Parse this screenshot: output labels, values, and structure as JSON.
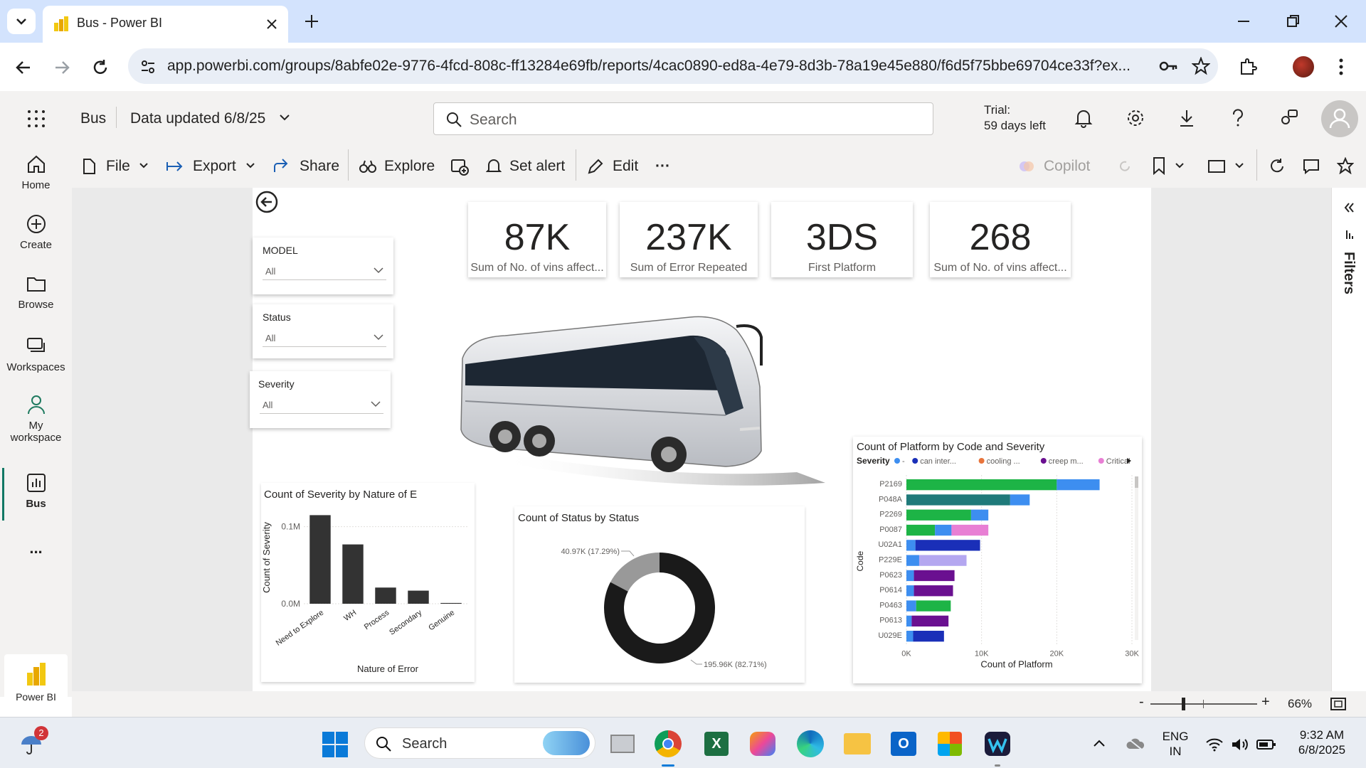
{
  "browser": {
    "tab_title": "Bus - Power BI",
    "url": "app.powerbi.com/groups/8abfe02e-9776-4fcd-808c-ff13284e69fb/reports/4cac0890-ed8a-4e79-8d3b-78a19e45e880/f6d5f75bbe69704ce33f?ex..."
  },
  "header": {
    "app_name": "Bus",
    "data_updated": "Data updated 6/8/25",
    "search_placeholder": "Search",
    "trial_line1": "Trial:",
    "trial_line2": "59 days left"
  },
  "nav": {
    "home": "Home",
    "create": "Create",
    "browse": "Browse",
    "workspaces": "Workspaces",
    "my_workspace_1": "My",
    "my_workspace_2": "workspace",
    "bus": "Bus",
    "more": "...",
    "powerbi": "Power BI"
  },
  "toolbar": {
    "file": "File",
    "export": "Export",
    "share": "Share",
    "explore": "Explore",
    "set_alert": "Set alert",
    "edit": "Edit",
    "more": "···",
    "copilot": "Copilot"
  },
  "kpis": [
    {
      "value": "87K",
      "label": "Sum of No. of vins affect..."
    },
    {
      "value": "237K",
      "label": "Sum of Error Repeated"
    },
    {
      "value": "3DS",
      "label": "First Platform"
    },
    {
      "value": "268",
      "label": "Sum of No. of vins affect..."
    }
  ],
  "slicers": [
    {
      "label": "MODEL",
      "value": "All"
    },
    {
      "label": "Status",
      "value": "All"
    },
    {
      "label": "Severity",
      "value": "All"
    }
  ],
  "filters_label": "Filters",
  "zoom": "66%",
  "colors": {
    "bar_dark": "#333333",
    "donut_dark": "#1a1a1a",
    "donut_light": "#999999",
    "green": "#1db446",
    "blue": "#3d8ef0",
    "teal": "#1f7a7a",
    "navy": "#1a2fb8",
    "purple": "#6a1090",
    "pink": "#e87fd4",
    "lavender": "#b4a7f0"
  },
  "chart_data": [
    {
      "type": "bar",
      "title": "Count of Severity by Nature of E",
      "xlabel": "Nature of Error",
      "ylabel": "Count of Severity",
      "categories": [
        "Need to Explore",
        "WH",
        "Process",
        "Secondary",
        "Genuine"
      ],
      "values": [
        0.115,
        0.077,
        0.021,
        0.017,
        0.001
      ],
      "yticks": [
        "0.1M",
        "0.0M"
      ],
      "ylim": [
        0,
        0.12
      ]
    },
    {
      "type": "pie",
      "title": "Count of Status by Status",
      "labels": [
        "40.97K (17.29%)",
        "195.96K (82.71%)"
      ],
      "values": [
        40.97,
        195.96
      ],
      "percents": [
        17.29,
        82.71
      ]
    },
    {
      "type": "bar",
      "orientation": "horizontal",
      "stacked": true,
      "title": "Count of Platform by Code and Severity",
      "xlabel": "Count of Platform",
      "ylabel": "Code",
      "legend_title": "Severity",
      "legend": [
        {
          "name": "-",
          "color": "#3d8ef0"
        },
        {
          "name": "can inter...",
          "color": "#1a2fb8"
        },
        {
          "name": "cooling ...",
          "color": "#e8743b"
        },
        {
          "name": "creep m...",
          "color": "#6a1090"
        },
        {
          "name": "Critical",
          "color": "#e87fd4"
        }
      ],
      "xticks": [
        "0K",
        "10K",
        "20K",
        "30K"
      ],
      "xlim": [
        0,
        30000
      ],
      "rows": [
        {
          "code": "P2169",
          "segments": [
            {
              "v": 20000,
              "c": "#1db446"
            },
            {
              "v": 5700,
              "c": "#3d8ef0"
            }
          ]
        },
        {
          "code": "P048A",
          "segments": [
            {
              "v": 13800,
              "c": "#1f7a7a"
            },
            {
              "v": 2600,
              "c": "#3d8ef0"
            }
          ]
        },
        {
          "code": "P2269",
          "segments": [
            {
              "v": 8600,
              "c": "#1db446"
            },
            {
              "v": 2300,
              "c": "#3d8ef0"
            }
          ]
        },
        {
          "code": "P0087",
          "segments": [
            {
              "v": 3800,
              "c": "#1db446"
            },
            {
              "v": 2200,
              "c": "#3d8ef0"
            },
            {
              "v": 4900,
              "c": "#e87fd4"
            }
          ]
        },
        {
          "code": "U02A1",
          "segments": [
            {
              "v": 1200,
              "c": "#3d8ef0"
            },
            {
              "v": 8600,
              "c": "#1a2fb8"
            }
          ]
        },
        {
          "code": "P229E",
          "segments": [
            {
              "v": 1700,
              "c": "#3d8ef0"
            },
            {
              "v": 6300,
              "c": "#b4a7f0"
            }
          ]
        },
        {
          "code": "P0623",
          "segments": [
            {
              "v": 1000,
              "c": "#3d8ef0"
            },
            {
              "v": 5400,
              "c": "#6a1090"
            }
          ]
        },
        {
          "code": "P0614",
          "segments": [
            {
              "v": 1000,
              "c": "#3d8ef0"
            },
            {
              "v": 5200,
              "c": "#6a1090"
            }
          ]
        },
        {
          "code": "P0463",
          "segments": [
            {
              "v": 1300,
              "c": "#3d8ef0"
            },
            {
              "v": 4600,
              "c": "#1db446"
            }
          ]
        },
        {
          "code": "P0613",
          "segments": [
            {
              "v": 700,
              "c": "#3d8ef0"
            },
            {
              "v": 4900,
              "c": "#6a1090"
            }
          ]
        },
        {
          "code": "U029E",
          "segments": [
            {
              "v": 900,
              "c": "#3d8ef0"
            },
            {
              "v": 4100,
              "c": "#1a2fb8"
            }
          ]
        }
      ]
    }
  ],
  "taskbar": {
    "search": "Search",
    "badge": "2",
    "lang1": "ENG",
    "lang2": "IN",
    "time": "9:32 AM",
    "date": "6/8/2025"
  }
}
